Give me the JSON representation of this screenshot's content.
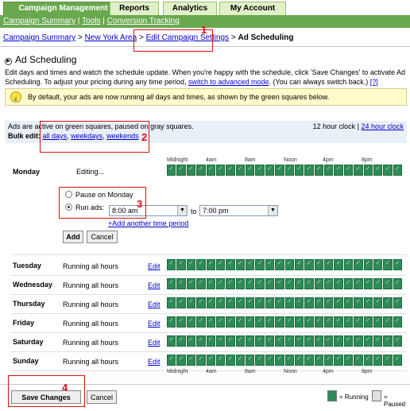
{
  "tabs": [
    "Campaign Management",
    "Reports",
    "Analytics",
    "My Account"
  ],
  "subnav": [
    "Campaign Summary",
    "Tools",
    "Conversion Tracking"
  ],
  "breadcrumb": {
    "items": [
      "Campaign Summary",
      "New York Area",
      "Edit Campaign Settings"
    ],
    "current": "Ad Scheduling",
    "sep": ">"
  },
  "page_title": "Ad Scheduling",
  "intro": {
    "text1": "Edit days and times and watch the schedule update. When you're happy with the schedule, click 'Save Changes' to activate Ad Scheduling. To adjust your pricing during any time period,",
    "link": "switch to advanced mode",
    "text2": ". (You can always switch back.)",
    "help": "[?]"
  },
  "notice": {
    "before": "By default, your ads are now running",
    "em": "all",
    "after": "days and times, as shown by the green squares below."
  },
  "legend": {
    "line1": "Ads are active on green squares, paused on gray squares.",
    "bulk_label": "Bulk edit:",
    "bulk_links": [
      "all days",
      "weekdays",
      "weekends"
    ],
    "clock_12": "12 hour clock",
    "clock_sep": "|",
    "clock_24": "24 hour clock"
  },
  "time_labels": [
    "Midnight",
    "4am",
    "8am",
    "Noon",
    "4pm",
    "8pm"
  ],
  "editing": {
    "day": "Monday",
    "status": "Editing...",
    "pause_label": "Pause on Monday",
    "run_label": "Run ads:",
    "from": "8:00 am",
    "to_label": "to",
    "to": "7:00 pm",
    "add_link": "+Add another time period",
    "add_btn": "Add",
    "cancel_btn": "Cancel"
  },
  "days": [
    {
      "name": "Tuesday",
      "status": "Running all hours",
      "edit": "Edit"
    },
    {
      "name": "Wednesday",
      "status": "Running all hours",
      "edit": "Edit"
    },
    {
      "name": "Thursday",
      "status": "Running all hours",
      "edit": "Edit"
    },
    {
      "name": "Friday",
      "status": "Running all hours",
      "edit": "Edit"
    },
    {
      "name": "Saturday",
      "status": "Running all hours",
      "edit": "Edit"
    },
    {
      "name": "Sunday",
      "status": "Running all hours",
      "edit": "Edit"
    }
  ],
  "footer": {
    "save": "Save Changes",
    "cancel": "Cancel",
    "running": "= Running",
    "paused": "= Paused"
  },
  "annotations": [
    "1",
    "2",
    "3",
    "4"
  ],
  "colors": {
    "accent": "#6aa84f",
    "running": "#2e8b57",
    "annotation": "#dd1111"
  }
}
